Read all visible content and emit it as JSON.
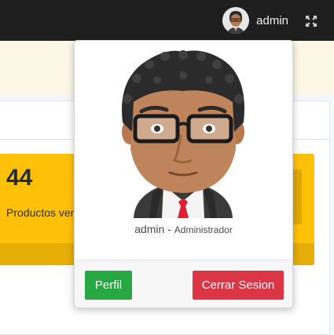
{
  "navbar": {
    "username": "admin",
    "avatar_icon": "user-avatar",
    "fullscreen_icon": "expand-arrows-icon"
  },
  "stats": {
    "value": "44",
    "label": "Productos vendidos",
    "color": "#ffc107"
  },
  "user_menu": {
    "name": "admin",
    "separator": " - ",
    "role": "Administrador",
    "profile_label": "Perfil",
    "logout_label": "Cerrar Sesion",
    "profile_color": "#28a745",
    "logout_color": "#dc3545"
  }
}
